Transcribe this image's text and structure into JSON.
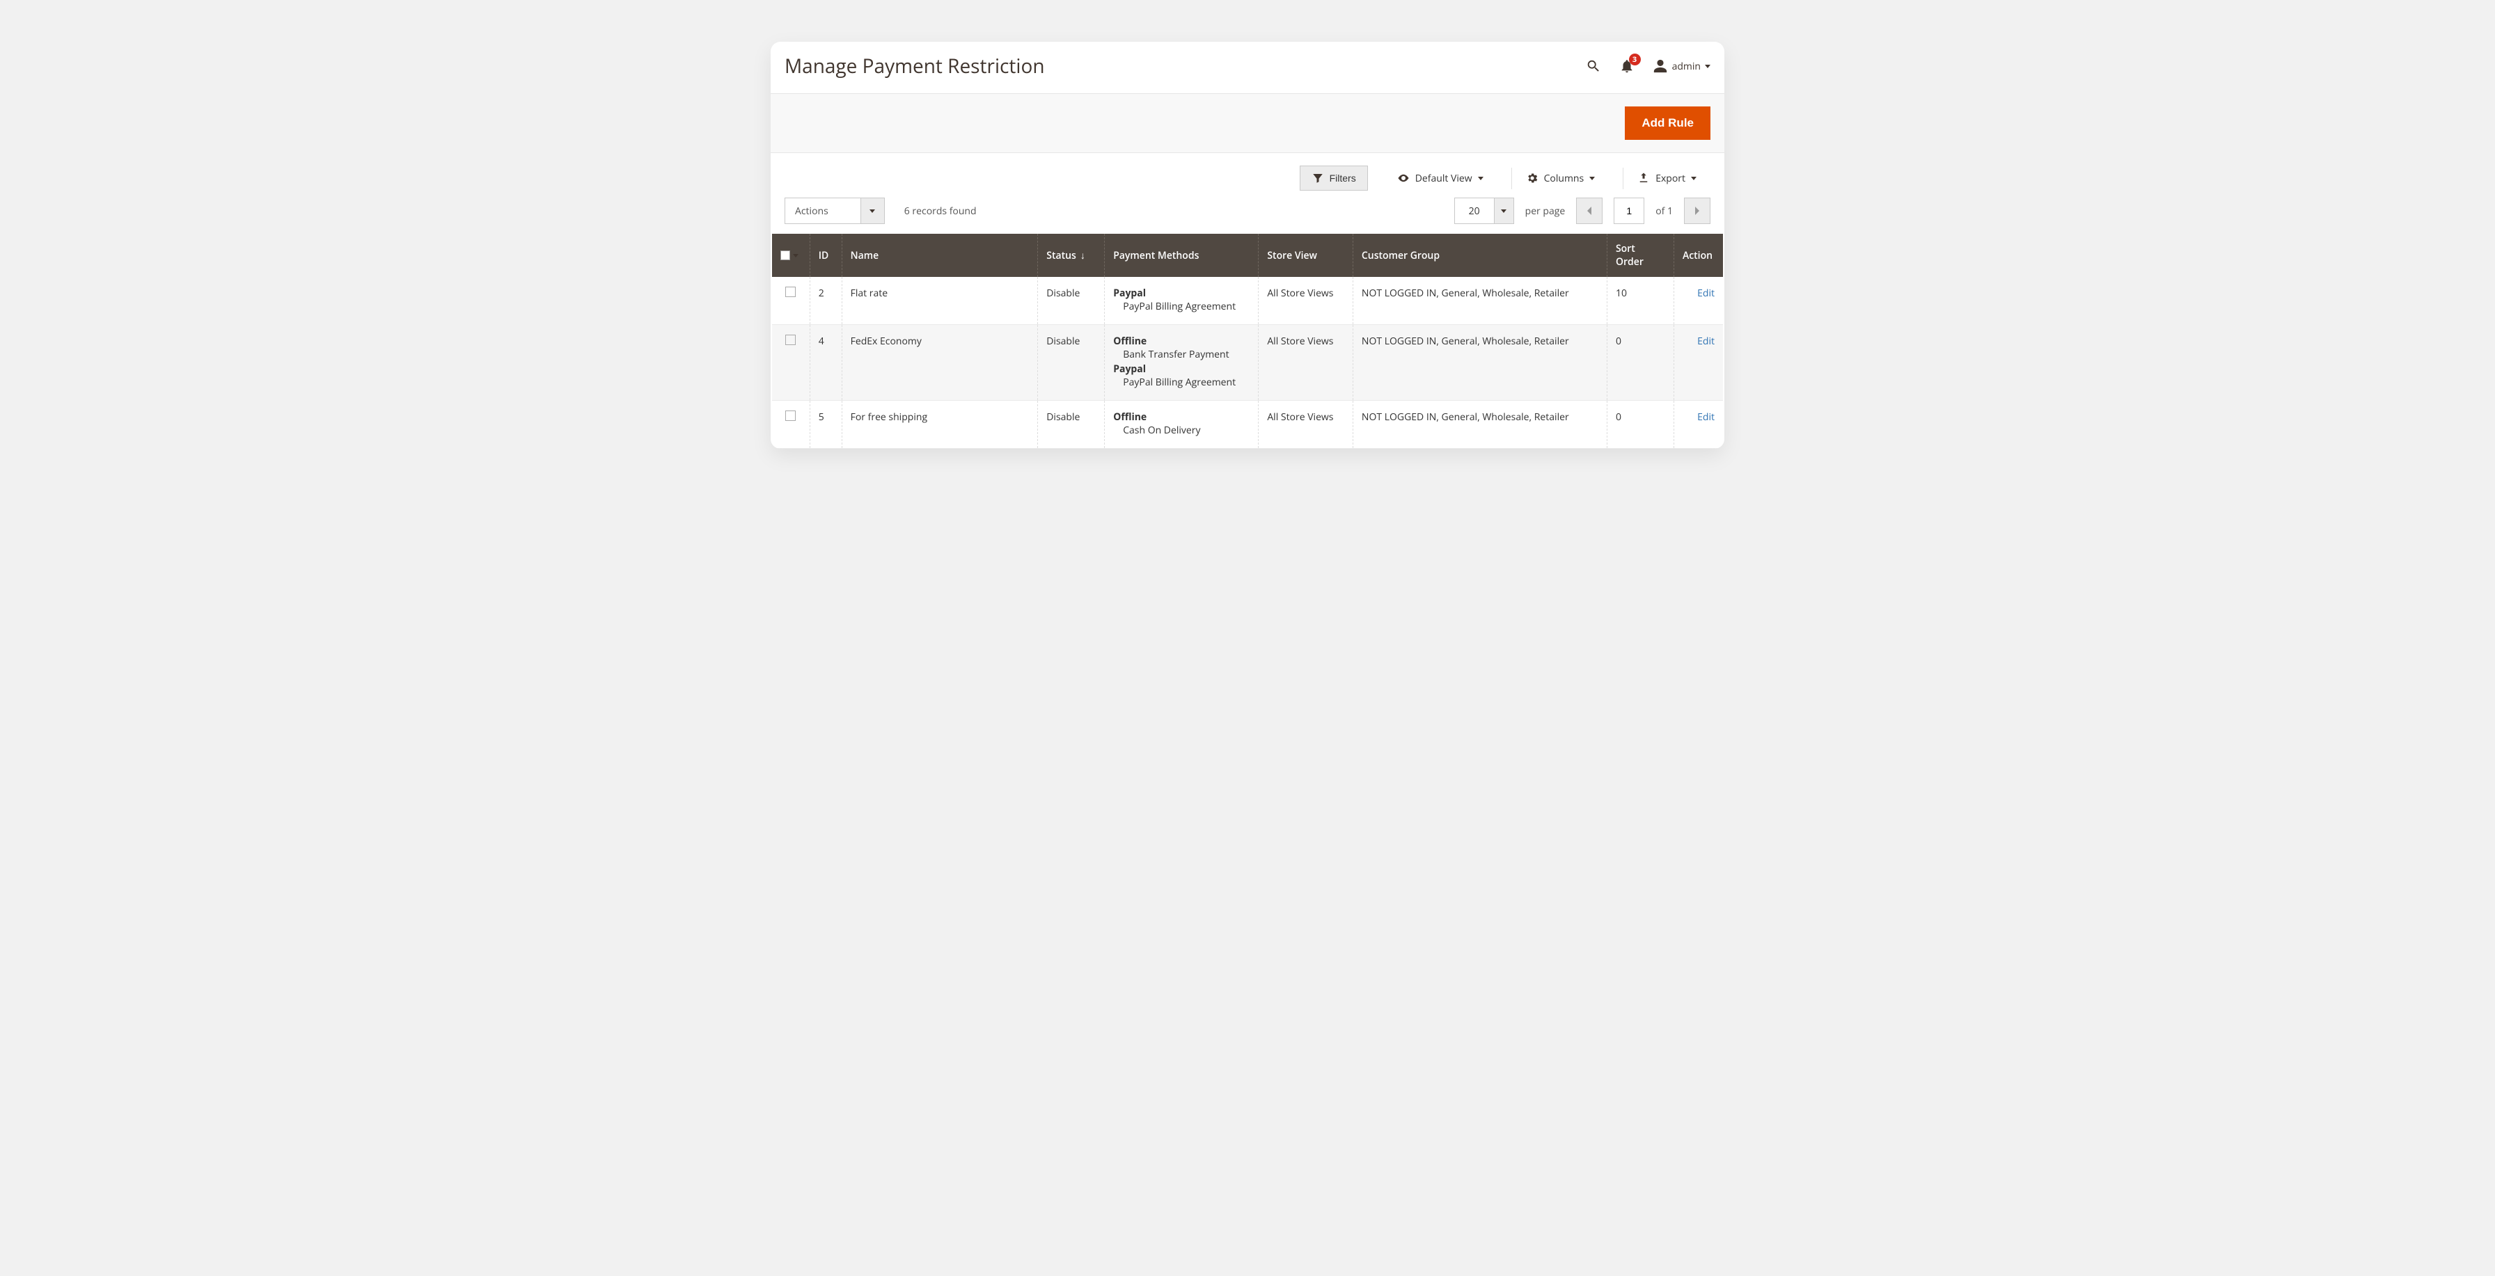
{
  "header": {
    "title": "Manage Payment Restriction",
    "notification_count": "3",
    "admin_label": "admin"
  },
  "buttons": {
    "add_rule": "Add Rule"
  },
  "toolbar": {
    "filters": "Filters",
    "default_view": "Default View",
    "columns": "Columns",
    "export": "Export"
  },
  "grid_controls": {
    "actions_label": "Actions",
    "records_found": "6 records found",
    "per_page_value": "20",
    "per_page_label": "per page",
    "page_current": "1",
    "page_total": "of 1"
  },
  "columns": {
    "id": "ID",
    "name": "Name",
    "status": "Status",
    "payment_methods": "Payment Methods",
    "store_view": "Store View",
    "customer_group": "Customer Group",
    "sort_order": "Sort Order",
    "action": "Action"
  },
  "rows": [
    {
      "id": "2",
      "name": "Flat rate",
      "status": "Disable",
      "pm": [
        {
          "title": "Paypal",
          "subs": [
            "PayPal Billing Agreement"
          ]
        }
      ],
      "store_view": "All Store Views",
      "customer_group": "NOT LOGGED IN, General, Wholesale, Retailer",
      "sort_order": "10",
      "action": "Edit"
    },
    {
      "id": "4",
      "name": "FedEx Economy",
      "status": "Disable",
      "pm": [
        {
          "title": "Offline",
          "subs": [
            "Bank Transfer Payment"
          ]
        },
        {
          "title": "Paypal",
          "subs": [
            "PayPal Billing Agreement"
          ]
        }
      ],
      "store_view": "All Store Views",
      "customer_group": "NOT LOGGED IN, General, Wholesale, Retailer",
      "sort_order": "0",
      "action": "Edit"
    },
    {
      "id": "5",
      "name": "For free shipping",
      "status": "Disable",
      "pm": [
        {
          "title": "Offline",
          "subs": [
            "Cash On Delivery"
          ]
        }
      ],
      "store_view": "All Store Views",
      "customer_group": "NOT LOGGED IN, General, Wholesale, Retailer",
      "sort_order": "0",
      "action": "Edit"
    }
  ]
}
